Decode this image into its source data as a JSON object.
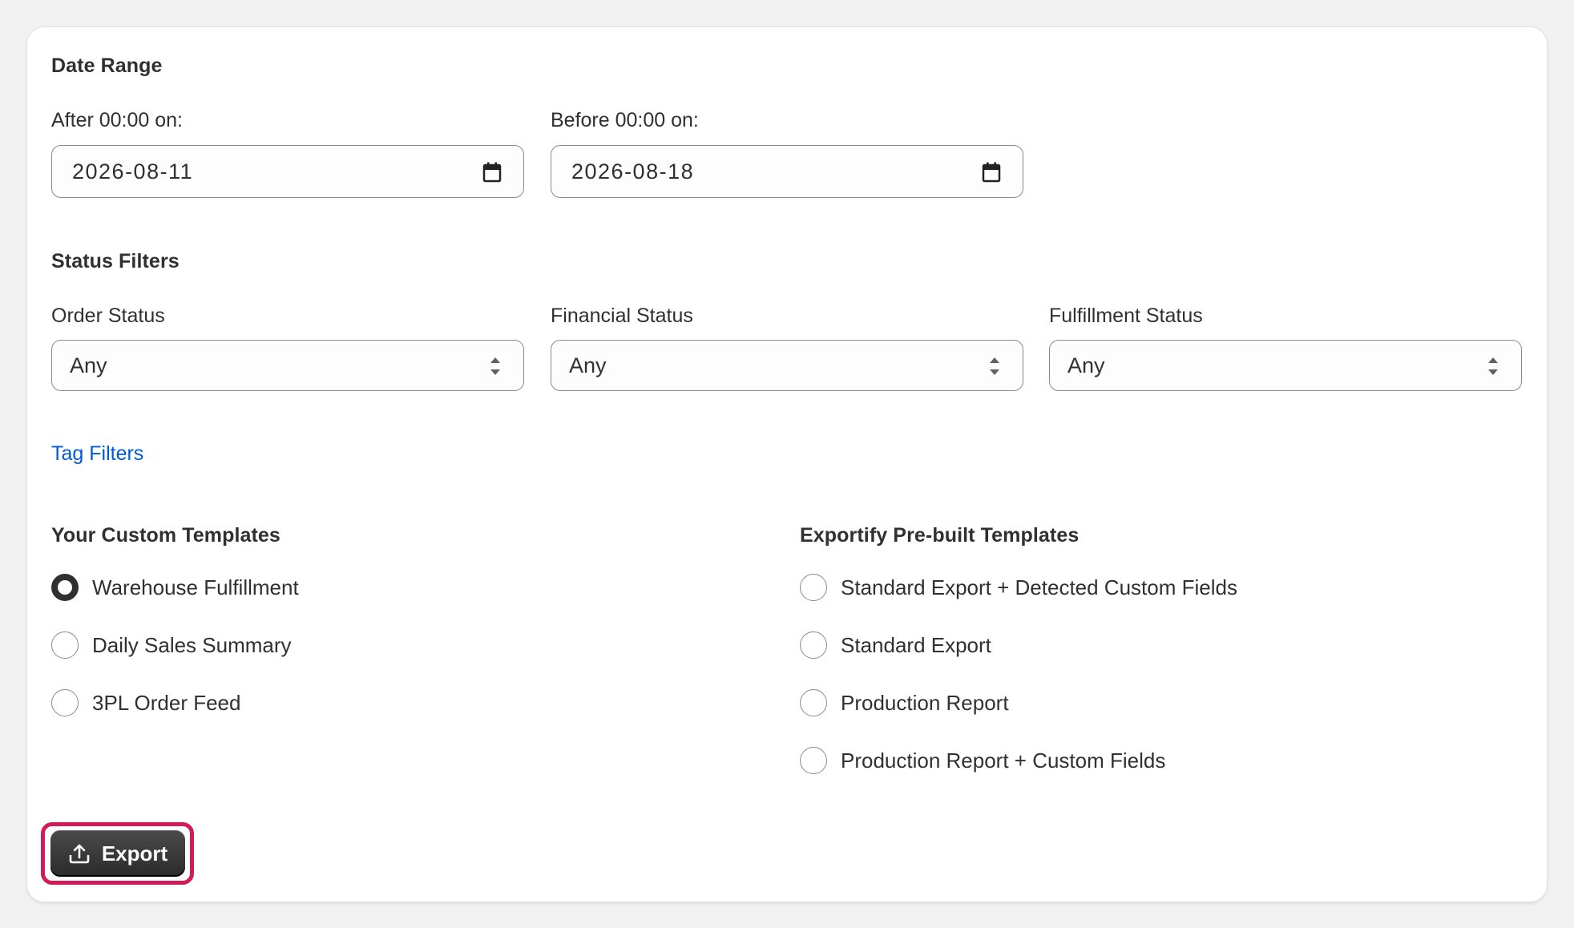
{
  "date_range": {
    "title": "Date Range",
    "after_label": "After 00:00 on:",
    "after_value": "2026-08-11",
    "before_label": "Before 00:00 on:",
    "before_value": "2026-08-18"
  },
  "status_filters": {
    "title": "Status Filters",
    "order_status": {
      "label": "Order Status",
      "value": "Any"
    },
    "financial_status": {
      "label": "Financial Status",
      "value": "Any"
    },
    "fulfillment_status": {
      "label": "Fulfillment Status",
      "value": "Any"
    }
  },
  "tag_filters": {
    "label": "Tag Filters"
  },
  "custom_templates": {
    "title": "Your Custom Templates",
    "options": [
      {
        "label": "Warehouse Fulfillment",
        "checked": true
      },
      {
        "label": "Daily Sales Summary",
        "checked": false
      },
      {
        "label": "3PL Order Feed",
        "checked": false
      }
    ]
  },
  "prebuilt_templates": {
    "title": "Exportify Pre-built Templates",
    "options": [
      {
        "label": "Standard Export + Detected Custom Fields",
        "checked": false
      },
      {
        "label": "Standard Export",
        "checked": false
      },
      {
        "label": "Production Report",
        "checked": false
      },
      {
        "label": "Production Report + Custom Fields",
        "checked": false
      }
    ]
  },
  "export_button": {
    "label": "Export"
  },
  "colors": {
    "link": "#005bd3",
    "highlight": "#d21c5a",
    "button_bg": "#303030"
  }
}
